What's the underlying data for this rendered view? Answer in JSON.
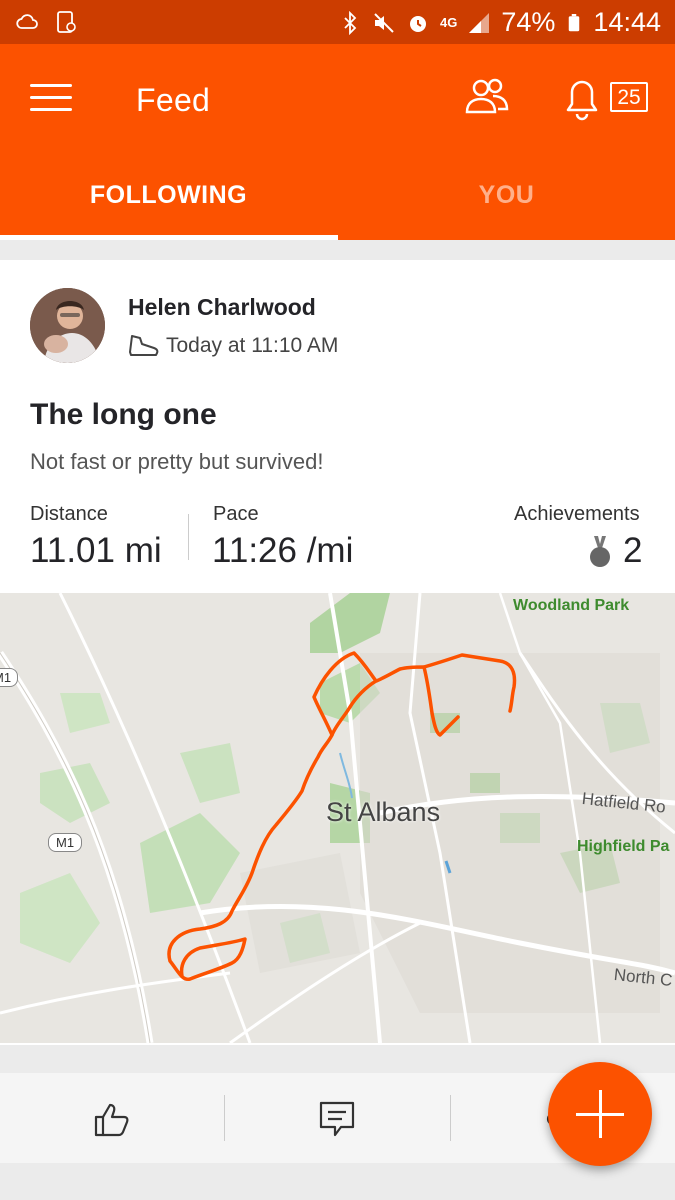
{
  "status_bar": {
    "battery": "74%",
    "time": "14:44",
    "network": "4G",
    "icons": [
      "cloud-sync-icon",
      "screenshot-icon",
      "bluetooth-icon",
      "mute-icon",
      "alarm-icon",
      "signal-icon",
      "battery-icon"
    ]
  },
  "app_bar": {
    "title": "Feed",
    "notification_count": "25",
    "tabs": [
      {
        "label": "FOLLOWING",
        "active": true
      },
      {
        "label": "YOU",
        "active": false
      }
    ],
    "colors": {
      "brand": "#fc5200",
      "status_bar": "#cc3d00"
    }
  },
  "activity": {
    "athlete_name": "Helen Charlwood",
    "timestamp": "Today at 11:10 AM",
    "title": "The long one",
    "description": "Not fast or pretty but survived!",
    "stats": [
      {
        "label": "Distance",
        "value": "11.01 mi"
      },
      {
        "label": "Pace",
        "value": "11:26 /mi"
      },
      {
        "label": "Achievements",
        "value": "2"
      }
    ]
  },
  "map": {
    "labels": {
      "town": "St Albans",
      "woodland": "Woodland Park",
      "road_east": "Hatfield Ro",
      "highfield": "Highfield Pa",
      "north": "North C",
      "m1_top": "M1",
      "m1_mid": "M1"
    },
    "route_color": "#fc5200"
  },
  "action_bar": {
    "icons": [
      "like-icon",
      "comment-icon",
      "share-icon"
    ]
  }
}
